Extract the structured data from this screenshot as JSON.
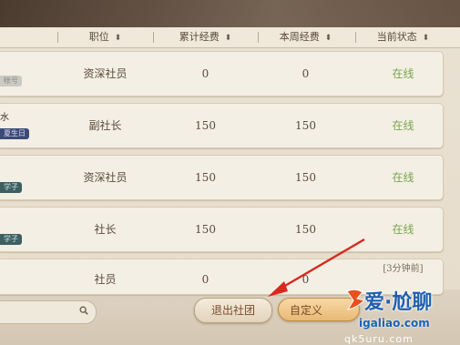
{
  "table": {
    "headers": [
      {
        "label": "职位"
      },
      {
        "label": "累计经费"
      },
      {
        "label": "本周经费"
      },
      {
        "label": "当前状态"
      }
    ],
    "rows": [
      {
        "name_fragment": "",
        "tag": "帐号",
        "position": "资深社员",
        "total_funds": "0",
        "weekly_funds": "0",
        "status": "在线"
      },
      {
        "name_fragment": "水",
        "tag": "夏生日",
        "position": "副社长",
        "total_funds": "150",
        "weekly_funds": "150",
        "status": "在线"
      },
      {
        "name_fragment": "",
        "tag": "学子",
        "position": "资深社员",
        "total_funds": "150",
        "weekly_funds": "150",
        "status": "在线"
      },
      {
        "name_fragment": "",
        "tag": "学子",
        "position": "社长",
        "total_funds": "150",
        "weekly_funds": "150",
        "status": "在线"
      },
      {
        "name_fragment": "",
        "tag": "",
        "position": "社员",
        "total_funds": "0",
        "weekly_funds": "0",
        "status": "[3分钟前]"
      }
    ]
  },
  "footer": {
    "leave_button": "退出社团",
    "custom_button": "自定义"
  },
  "watermark": {
    "title": "爱·尬聊",
    "url": "igaliao.com",
    "url2": "qk5uru.com"
  }
}
